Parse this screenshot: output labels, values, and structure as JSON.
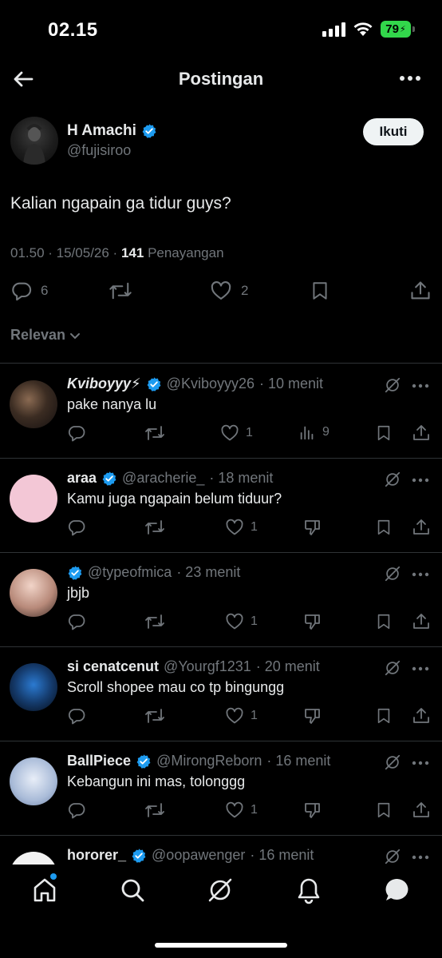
{
  "status_bar": {
    "time": "02.15",
    "battery": "79"
  },
  "header": {
    "title": "Postingan"
  },
  "post": {
    "author_name": "H Amachi",
    "author_handle": "@fujisiroo",
    "follow_label": "Ikuti",
    "text": "Kalian ngapain ga tidur guys?",
    "meta_time": "01.50 · 15/05/26 ·",
    "views_count": "141",
    "views_label": "Penayangan",
    "reply_count": "6",
    "like_count": "2"
  },
  "sort": {
    "label": "Relevan"
  },
  "replies": [
    {
      "name": "Kviboyyy⚡",
      "handle": "@Kviboyyy26",
      "time": "· 10 menit",
      "text": "pake nanya lu",
      "likes": "1",
      "views": "9",
      "verified": true
    },
    {
      "name": "araa",
      "handle": "@aracherie_",
      "time": "· 18 menit",
      "text": "Kamu juga ngapain belum tiduur?",
      "likes": "1",
      "verified": true
    },
    {
      "name": "",
      "handle": "@typeofmica",
      "time": "· 23 menit",
      "text": "jbjb",
      "likes": "1",
      "verified": true
    },
    {
      "name": "si cenatcenut",
      "handle": "@Yourgf1231",
      "time": "· 20 menit",
      "text": "Scroll shopee mau co tp bingungg",
      "likes": "1",
      "verified": false
    },
    {
      "name": "BallPiece",
      "handle": "@MirongReborn",
      "time": "· 16 menit",
      "text": "Kebangun ini mas, tolonggg",
      "likes": "1",
      "verified": true
    },
    {
      "name": "hororer_",
      "handle": "@oopawenger",
      "time": "· 16 menit",
      "text": "",
      "likes": "",
      "verified": true
    }
  ],
  "colors": {
    "accent": "#1d9bf0",
    "muted": "#71767b",
    "divider": "#2f3336",
    "battery": "#32d74b"
  },
  "icons": [
    "back-arrow-icon",
    "more-dots-icon",
    "verified-icon",
    "reply-icon",
    "repost-icon",
    "like-icon",
    "views-icon",
    "dislike-icon",
    "bookmark-icon",
    "share-icon",
    "grok-icon",
    "home-icon",
    "search-icon",
    "notifications-icon",
    "messages-icon"
  ]
}
